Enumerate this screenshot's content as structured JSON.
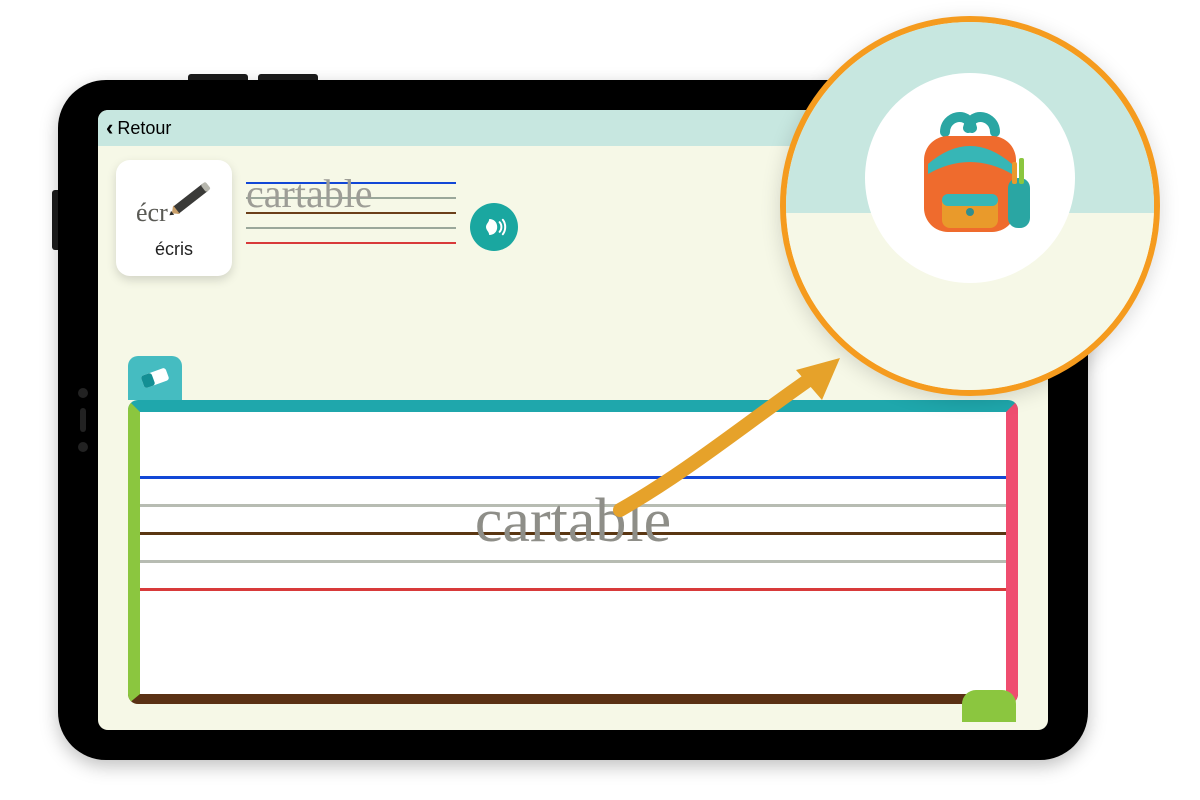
{
  "header": {
    "back_label": "Retour"
  },
  "mode_card": {
    "hint_text": "écr",
    "label": "écris"
  },
  "model": {
    "word": "cartable"
  },
  "practice": {
    "word": "cartable"
  },
  "icons": {
    "pencil": "pencil-icon",
    "speak": "speak-icon",
    "eraser": "eraser-icon",
    "backpack": "backpack-icon",
    "arrow": "callout-arrow-icon"
  },
  "colors": {
    "header_bg": "#c7e7e0",
    "screen_bg": "#f6f8e7",
    "accent_teal": "#1fa7ac",
    "accent_green": "#8bc63f",
    "accent_pink": "#ef4d6f",
    "accent_brown": "#5a3114",
    "callout_border": "#f59b1e"
  }
}
